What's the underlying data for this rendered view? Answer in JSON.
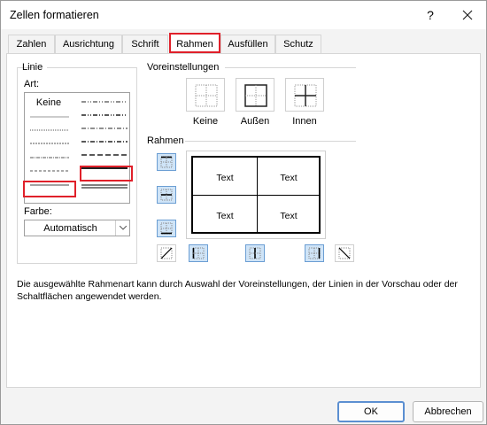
{
  "window": {
    "title": "Zellen formatieren",
    "help": "?"
  },
  "tabs": [
    "Zahlen",
    "Ausrichtung",
    "Schrift",
    "Rahmen",
    "Ausfüllen",
    "Schutz"
  ],
  "active_tab": "Rahmen",
  "linie": {
    "group_label": "Linie",
    "art_label": "Art:",
    "none_label": "Keine",
    "farbe_label": "Farbe:",
    "farbe_value": "Automatisch"
  },
  "voreinstellungen": {
    "label": "Voreinstellungen",
    "presets": [
      "Keine",
      "Außen",
      "Innen"
    ]
  },
  "rahmen": {
    "label": "Rahmen",
    "preview_cells": [
      "Text",
      "Text",
      "Text",
      "Text"
    ]
  },
  "description": "Die ausgewählte Rahmenart kann durch Auswahl der Voreinstellungen, der Linien in der Vorschau oder der Schaltflächen angewendet werden.",
  "buttons": {
    "ok": "OK",
    "cancel": "Abbrechen"
  },
  "colors": {
    "highlight": "#e0202a",
    "selected_toggle": "#cfe4f7"
  }
}
